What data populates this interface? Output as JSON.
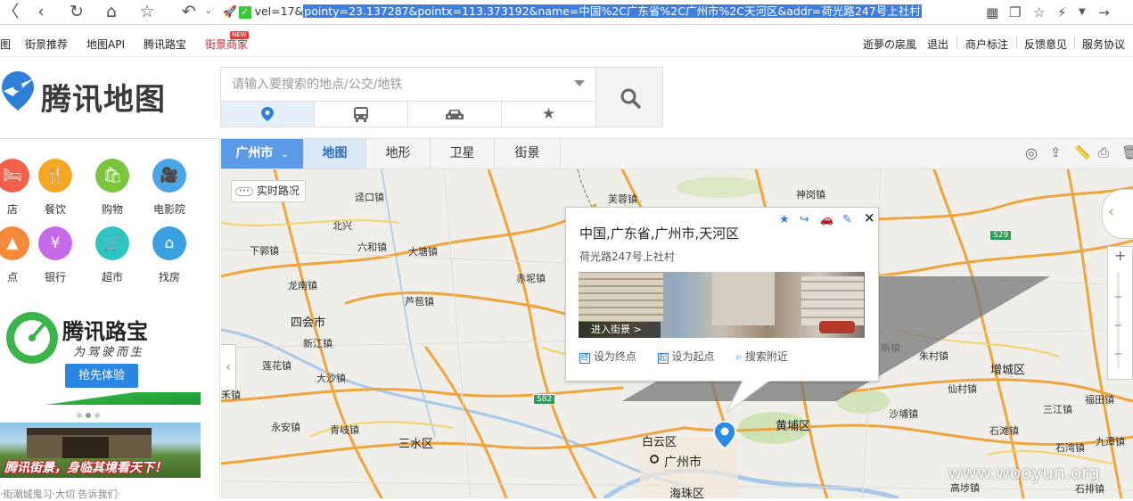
{
  "browser": {
    "url_prefix": "vel=17&",
    "url_selected": "pointy=23.137287&pointx=113.373192&name=中国%2C广东省%2C广州市%2C天河区&addr=荷光路247号上社村"
  },
  "bookmarks": {
    "left": [
      "图",
      "街景推荐",
      "地图API",
      "腾讯路宝",
      "街景商家"
    ],
    "new_badge": "NEW",
    "right": [
      "逝夢の扆風",
      "退出",
      "商户标注",
      "反馈意见",
      "服务协议"
    ]
  },
  "logo": {
    "text": "腾讯地图"
  },
  "search": {
    "placeholder": "请输入要搜索的地点/公交/地铁"
  },
  "categories": [
    {
      "label": "店",
      "color": "#f0604a"
    },
    {
      "label": "餐饮",
      "color": "#f5a623"
    },
    {
      "label": "购物",
      "color": "#7cc43b"
    },
    {
      "label": "电影院",
      "color": "#4aa6e8"
    },
    {
      "label": "点",
      "color": "#f58a3a"
    },
    {
      "label": "银行",
      "color": "#c56ae8"
    },
    {
      "label": "超市",
      "color": "#2fc3c3"
    },
    {
      "label": "找房",
      "color": "#3aa0e0"
    }
  ],
  "lubao": {
    "title": "腾讯路宝",
    "slogan": "为驾驶而生",
    "button": "抢先体验"
  },
  "streetview_banner": {
    "text": "腾讯街景，身临其境看天下！"
  },
  "footer_snippet": "·街潮城鬼习·大切  告诉我们·",
  "map_tabs": {
    "city": "广州市",
    "tabs": [
      "地图",
      "地形",
      "卫星",
      "街景"
    ]
  },
  "traffic_button": "实时路况",
  "popup": {
    "title": "中国,广东省,广州市,天河区",
    "address": "荷光路247号上社村",
    "enter_streetview": "进入街景 >",
    "actions": [
      "设为终点",
      "设为起点",
      "搜索附近"
    ],
    "action_icons": [
      "终",
      "起"
    ]
  },
  "map_labels": [
    "迳口镇",
    "芙蓉镇",
    "神岗镇",
    "北兴",
    "六和镇",
    "下郭镇",
    "大塘镇",
    "龙南镇",
    "赤坭镇",
    "芦苞镇",
    "四会市",
    "新江镇",
    "莲花镇",
    "大沙镇",
    "禾镇",
    "永安镇",
    "青岐镇",
    "三水区",
    "白云区",
    "广州市",
    "黄埔区",
    "新镇",
    "朱村镇",
    "增城区",
    "仙村镇",
    "沙埔镇",
    "石滩镇",
    "福田镇",
    "三江镇",
    "石湾镇",
    "九潭镇",
    "高埗镇",
    "海珠区",
    "石排镇"
  ],
  "road_badges": [
    "S29",
    "S82"
  ],
  "watermark": "www.wooyun.org",
  "colors": {
    "accent": "#3a8ee6",
    "road_orange": "#f0a43c",
    "pin_blue": "#2b8ae6"
  }
}
